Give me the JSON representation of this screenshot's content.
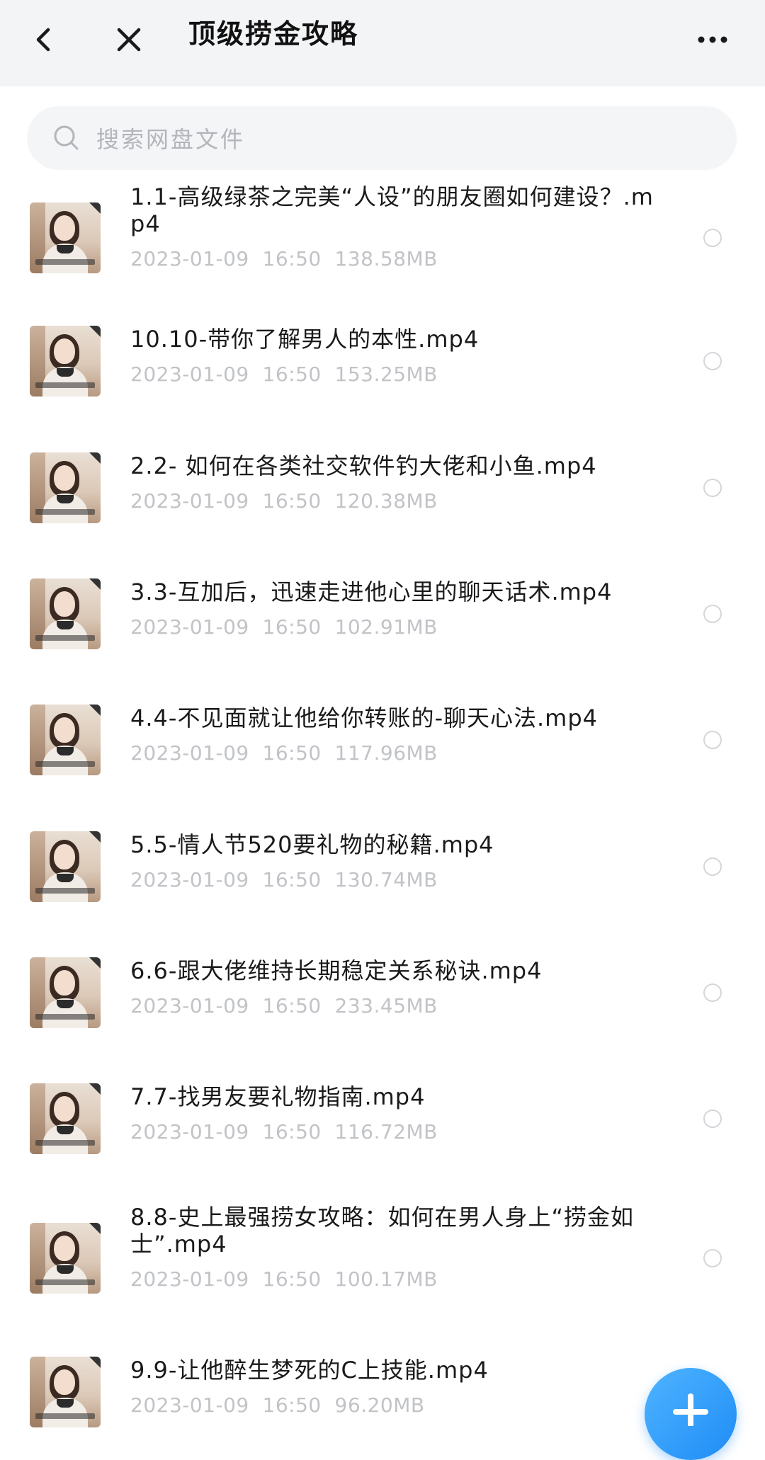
{
  "header": {
    "title": "顶级捞金攻略",
    "back_icon": "chevron-left-icon",
    "close_icon": "close-icon",
    "more_icon": "more-horizontal-icon"
  },
  "search": {
    "placeholder": "搜索网盘文件",
    "icon": "search-icon"
  },
  "files": [
    {
      "name": "1.1-高级绿茶之完美“人设”的朋友圈如何建设？.mp4",
      "date": "2023-01-09  16:50",
      "size": "138.58MB"
    },
    {
      "name": "10.10-带你了解男人的本性.mp4",
      "date": "2023-01-09  16:50",
      "size": "153.25MB"
    },
    {
      "name": "2.2- 如何在各类社交软件钓大佬和小鱼.mp4",
      "date": "2023-01-09  16:50",
      "size": "120.38MB"
    },
    {
      "name": "3.3-互加后，迅速走进他心里的聊天话术.mp4",
      "date": "2023-01-09  16:50",
      "size": "102.91MB"
    },
    {
      "name": "4.4-不见面就让他给你转账的-聊天心法.mp4",
      "date": "2023-01-09  16:50",
      "size": "117.96MB"
    },
    {
      "name": "5.5-情人节520要礼物的秘籍.mp4",
      "date": "2023-01-09  16:50",
      "size": "130.74MB"
    },
    {
      "name": "6.6-跟大佬维持长期稳定关系秘诀.mp4",
      "date": "2023-01-09  16:50",
      "size": "233.45MB"
    },
    {
      "name": "7.7-找男友要礼物指南.mp4",
      "date": "2023-01-09  16:50",
      "size": "116.72MB"
    },
    {
      "name": "8.8-史上最强捞女攻略：如何在男人身上“捞金如士”.mp4",
      "date": "2023-01-09  16:50",
      "size": "100.17MB"
    },
    {
      "name": "9.9-让他醉生梦死的C上技能.mp4",
      "date": "2023-01-09  16:50",
      "size": "96.20MB"
    }
  ],
  "fab": {
    "icon": "plus-icon"
  },
  "colors": {
    "accent": "#1e8cf6",
    "header_bg": "#f3f4f6",
    "meta_text": "#c1c3c7"
  }
}
